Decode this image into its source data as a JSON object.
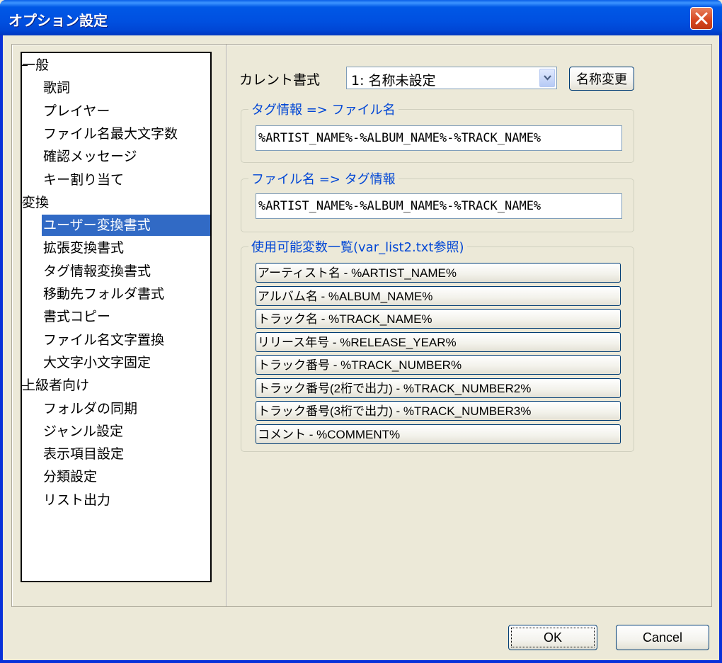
{
  "window": {
    "title": "オプション設定",
    "close_icon": "close-x-icon"
  },
  "tree": {
    "items": [
      {
        "label": "一般",
        "level": 0
      },
      {
        "label": "歌詞",
        "level": 1
      },
      {
        "label": "プレイヤー",
        "level": 1
      },
      {
        "label": "ファイル名最大文字数",
        "level": 1
      },
      {
        "label": "確認メッセージ",
        "level": 1
      },
      {
        "label": "キー割り当て",
        "level": 1
      },
      {
        "label": "変換",
        "level": 0
      },
      {
        "label": "ユーザー変換書式",
        "level": 1,
        "selected": true
      },
      {
        "label": "拡張変換書式",
        "level": 1
      },
      {
        "label": "タグ情報変換書式",
        "level": 1
      },
      {
        "label": "移動先フォルダ書式",
        "level": 1
      },
      {
        "label": "書式コピー",
        "level": 1
      },
      {
        "label": "ファイル名文字置換",
        "level": 1
      },
      {
        "label": "大文字小文字固定",
        "level": 1
      },
      {
        "label": "上級者向け",
        "level": 0
      },
      {
        "label": "フォルダの同期",
        "level": 1
      },
      {
        "label": "ジャンル設定",
        "level": 1
      },
      {
        "label": "表示項目設定",
        "level": 1
      },
      {
        "label": "分類設定",
        "level": 1
      },
      {
        "label": "リスト出力",
        "level": 1
      }
    ]
  },
  "current_format": {
    "label": "カレント書式",
    "selected": "1: 名称未設定",
    "dropdown_icon": "chevron-down-icon",
    "rename_label": "名称変更"
  },
  "tag_to_file": {
    "title": "タグ情報 => ファイル名",
    "value": "%ARTIST_NAME%-%ALBUM_NAME%-%TRACK_NAME%"
  },
  "file_to_tag": {
    "title": "ファイル名 => タグ情報",
    "value": "%ARTIST_NAME%-%ALBUM_NAME%-%TRACK_NAME%"
  },
  "variables": {
    "title": "使用可能変数一覧(var_list2.txt参照)",
    "items": [
      "アーティスト名 - %ARTIST_NAME%",
      "アルバム名 - %ALBUM_NAME%",
      "トラック名 - %TRACK_NAME%",
      "リリース年号 - %RELEASE_YEAR%",
      "トラック番号 - %TRACK_NUMBER%",
      "トラック番号(2桁で出力) - %TRACK_NUMBER2%",
      "トラック番号(3桁で出力) - %TRACK_NUMBER3%",
      "コメント - %COMMENT%"
    ]
  },
  "footer": {
    "ok_label": "OK",
    "cancel_label": "Cancel"
  }
}
